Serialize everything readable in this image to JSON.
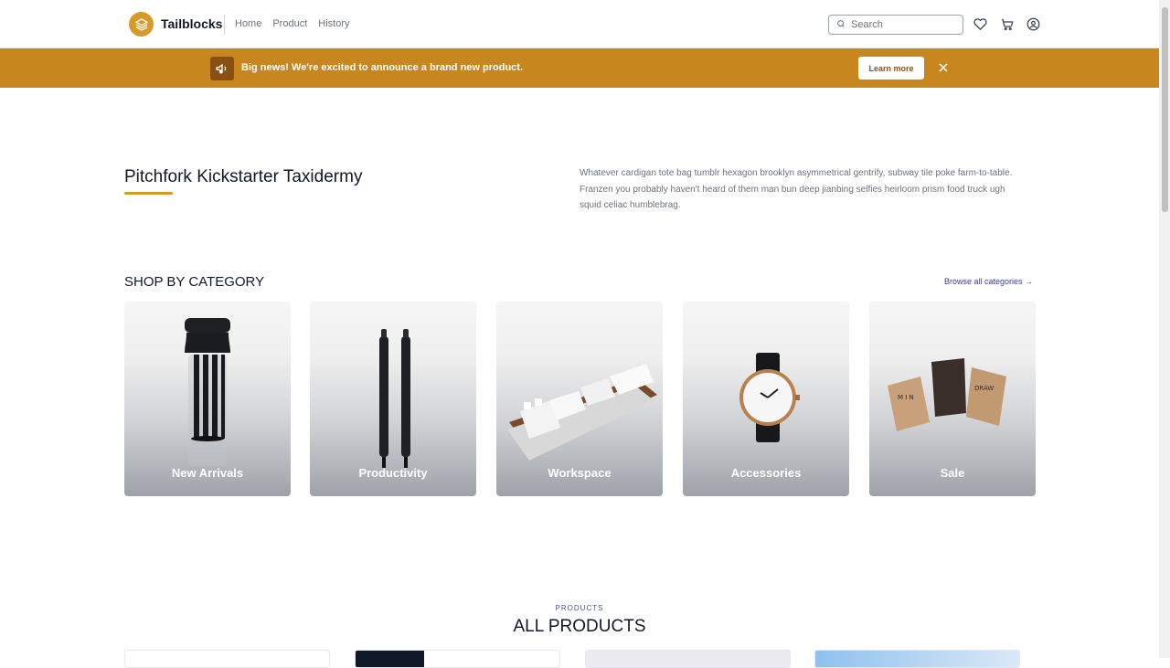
{
  "header": {
    "brand": "Tailblocks",
    "nav": [
      "Home",
      "Product",
      "History"
    ],
    "search_placeholder": "Search"
  },
  "announcement": {
    "text": "Big news! We're excited to announce a brand new product.",
    "button": "Learn more"
  },
  "hero": {
    "title": "Pitchfork Kickstarter Taxidermy",
    "description": "Whatever cardigan tote bag tumblr hexagon brooklyn asymmetrical gentrify, subway tile poke farm-to-table. Franzen you probably haven't heard of them man bun deep jianbing selfies heirloom prism food truck ugh squid celiac humblebrag."
  },
  "categories": {
    "title": "SHOP BY CATEGORY",
    "browse_link": "Browse all categories →",
    "items": [
      {
        "label": "New Arrivals"
      },
      {
        "label": "Productivity"
      },
      {
        "label": "Workspace"
      },
      {
        "label": "Accessories"
      },
      {
        "label": "Sale"
      }
    ]
  },
  "products": {
    "label": "PRODUCTS",
    "title": "ALL PRODUCTS"
  },
  "colors": {
    "accent": "#d79a29",
    "banner": "#c8861e",
    "link": "#3b3f8f"
  }
}
